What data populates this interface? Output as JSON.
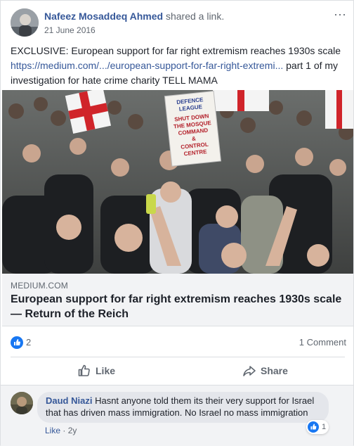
{
  "post": {
    "author": "Nafeez Mosaddeq Ahmed",
    "action": "shared a link.",
    "date": "21 June 2016",
    "text_1": "EXCLUSIVE: European support for far right extremism reaches 1930s scale",
    "link_url": "https://medium.com/.../european-support-for-far-right-extremi...",
    "text_2": " part 1 of my investigation for hate crime charity TELL MAMA",
    "more_icon": "ellipsis-icon"
  },
  "photo": {
    "banner_text": "DEFENCE LEAGUE SHUT DOWN THE MOSQUE COMMAND & CONTROL CENTRE"
  },
  "link_preview": {
    "domain": "MEDIUM.COM",
    "title": "European support for far right extremism reaches 1930s scale — Return of the Reich"
  },
  "engagement": {
    "reaction_count": "2",
    "comment_count": "1 Comment"
  },
  "actions": {
    "like_label": "Like",
    "share_label": "Share"
  },
  "comment": {
    "author": "Daud Niazi",
    "text": " Hasnt anyone told them its their very support for Israel that has driven mass immigration. No Israel no mass immigration",
    "like_label": "Like",
    "separator": " · ",
    "age": "2y",
    "reaction_count": "1"
  },
  "colors": {
    "link_blue": "#365899",
    "like_blue": "#1877f2",
    "secondary_text": "#606770"
  }
}
